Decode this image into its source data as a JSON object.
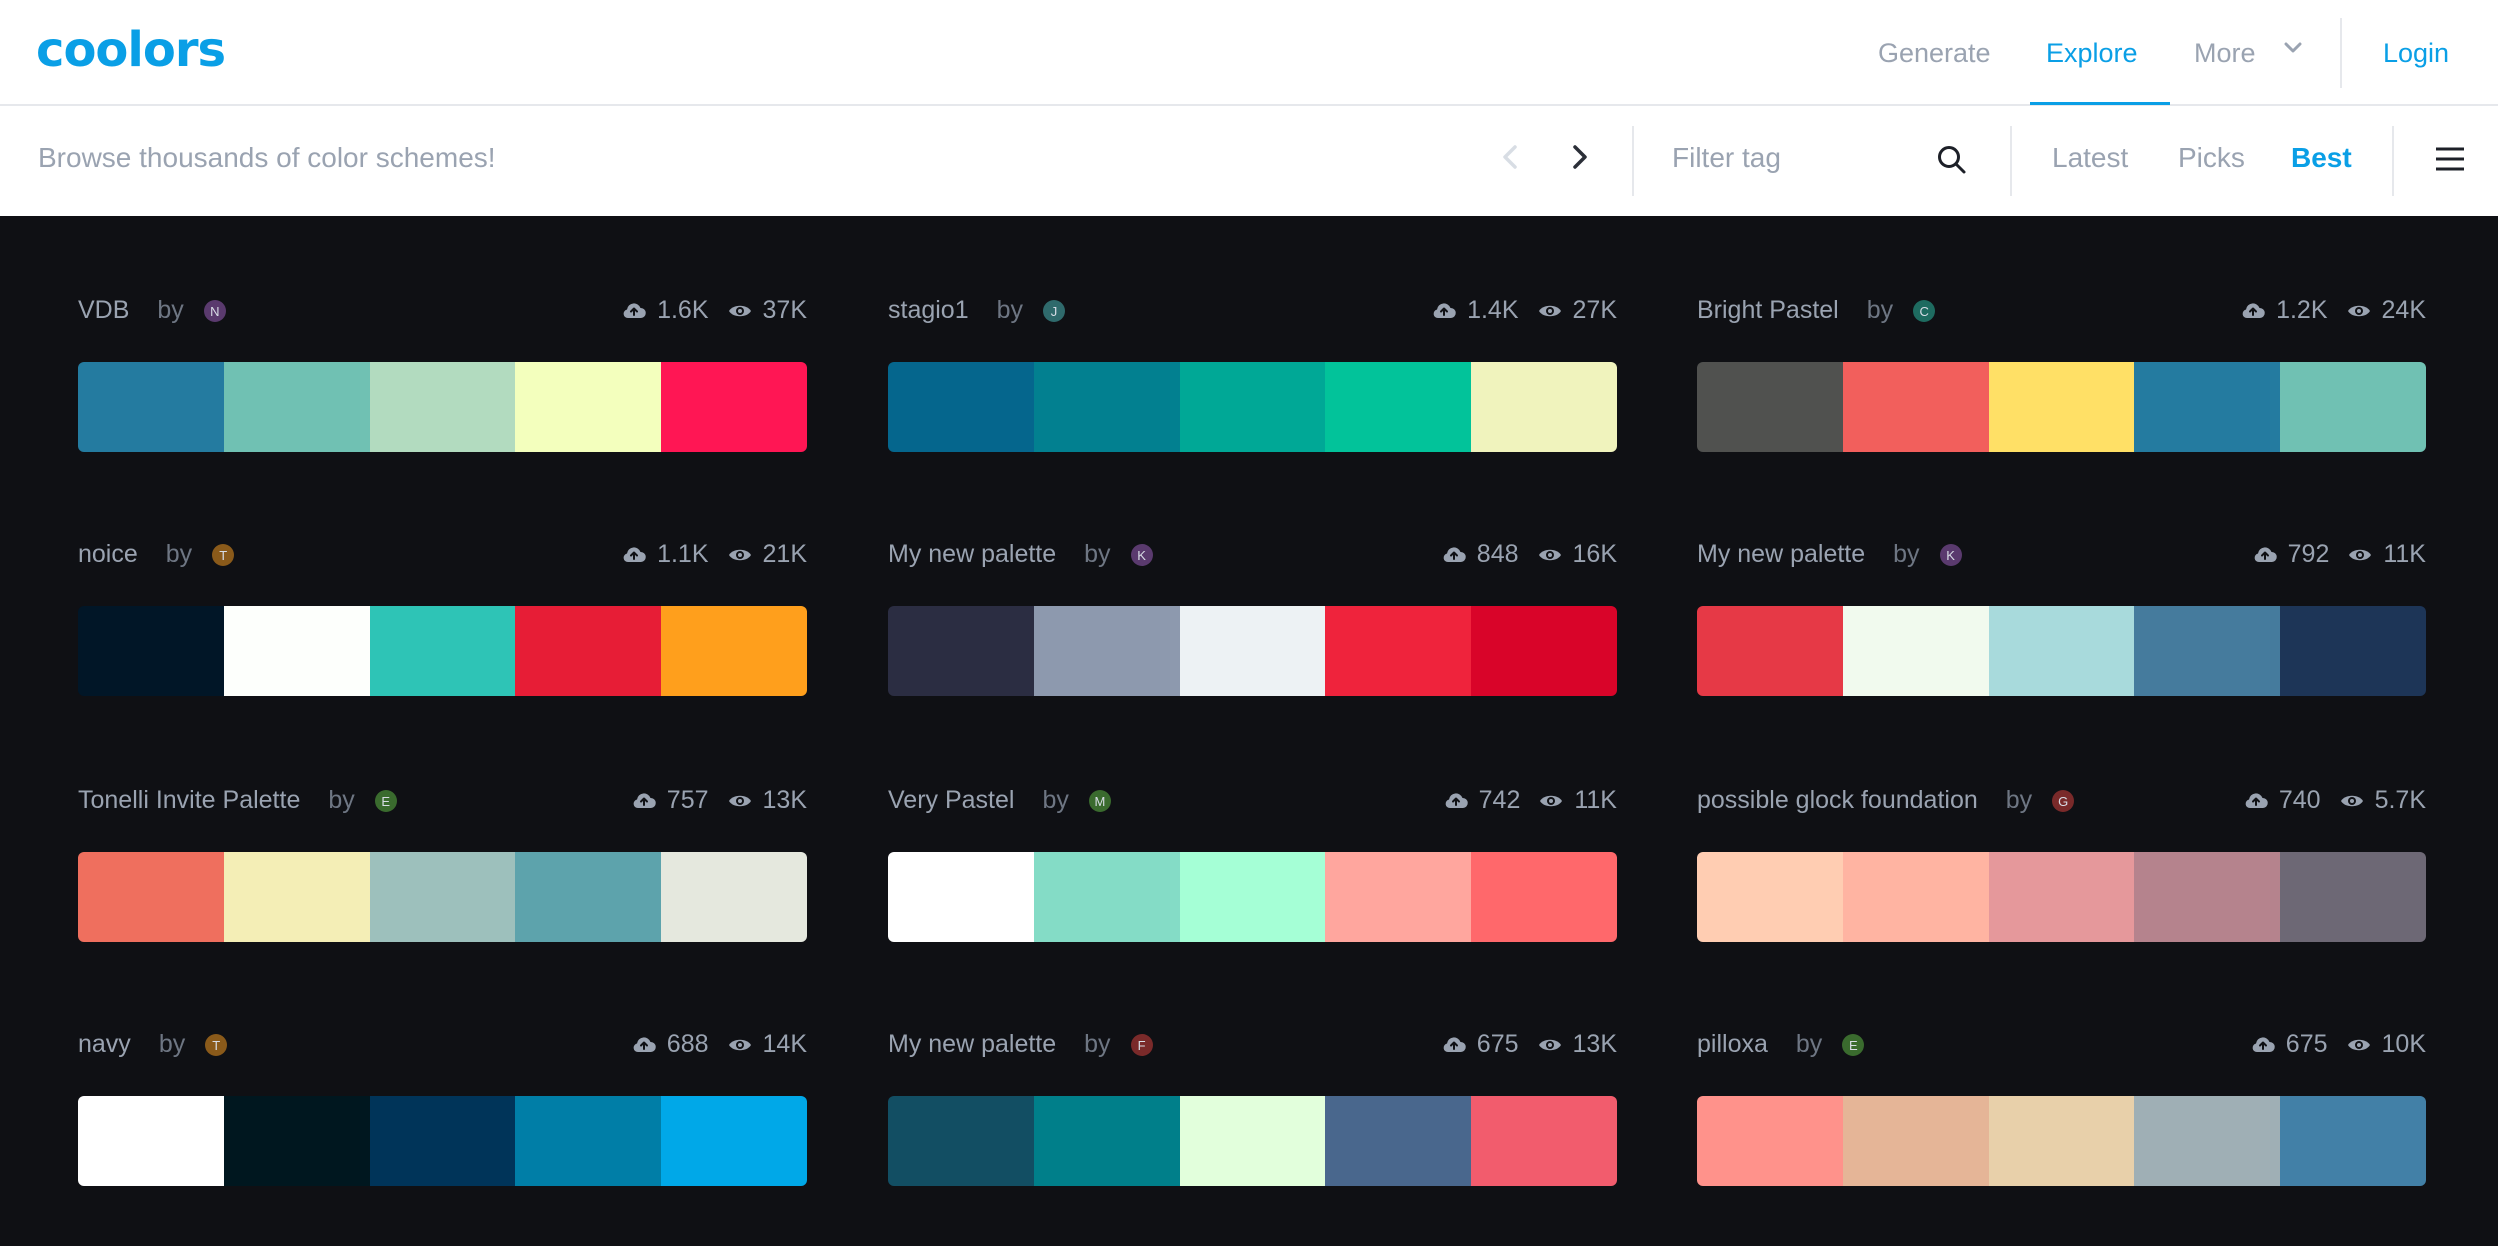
{
  "app": {
    "logo": "coolors"
  },
  "nav": {
    "generate": "Generate",
    "explore": "Explore",
    "more": "More",
    "login": "Login"
  },
  "toolbar": {
    "search_placeholder": "Browse thousands of color schemes!",
    "filter_placeholder": "Filter tag",
    "sort": {
      "latest": "Latest",
      "picks": "Picks",
      "best": "Best"
    }
  },
  "palettes": [
    {
      "name": "VDB",
      "by": "by",
      "avatar": "N",
      "avatar_color": "#5a3a6e",
      "saves": "1.6K",
      "views": "37K",
      "colors": [
        "#247BA0",
        "#70C1B3",
        "#B2DBBF",
        "#F3FFBD",
        "#FF1654"
      ]
    },
    {
      "name": "stagio1",
      "by": "by",
      "avatar": "J",
      "avatar_color": "#2f6a6c",
      "saves": "1.4K",
      "views": "27K",
      "colors": [
        "#05668D",
        "#028090",
        "#00A896",
        "#02C39A",
        "#F0F3BD"
      ]
    },
    {
      "name": "Bright Pastel",
      "by": "by",
      "avatar": "C",
      "avatar_color": "#1e6b60",
      "saves": "1.2K",
      "views": "24K",
      "colors": [
        "#50514F",
        "#F25F5C",
        "#FFE066",
        "#247BA0",
        "#70C1B3"
      ]
    },
    {
      "name": "noice",
      "by": "by",
      "avatar": "T",
      "avatar_color": "#8a5a1a",
      "saves": "1.1K",
      "views": "21K",
      "colors": [
        "#011627",
        "#FDFFFC",
        "#2EC4B6",
        "#E71D36",
        "#FF9F1C"
      ]
    },
    {
      "name": "My new palette",
      "by": "by",
      "avatar": "K",
      "avatar_color": "#5a3a6e",
      "saves": "848",
      "views": "16K",
      "colors": [
        "#2B2D42",
        "#8D99AE",
        "#EDF2F4",
        "#EF233C",
        "#D90429"
      ]
    },
    {
      "name": "My new palette",
      "by": "by",
      "avatar": "K",
      "avatar_color": "#5a3a6e",
      "saves": "792",
      "views": "11K",
      "colors": [
        "#E63946",
        "#F1FAEE",
        "#A8DADC",
        "#457B9D",
        "#1D3557"
      ]
    },
    {
      "name": "Tonelli Invite Palette",
      "by": "by",
      "avatar": "E",
      "avatar_color": "#3a6b2e",
      "saves": "757",
      "views": "13K",
      "colors": [
        "#EF6F5E",
        "#F4EEB6",
        "#9DC0BC",
        "#5DA3AC",
        "#E5E8DE"
      ]
    },
    {
      "name": "Very Pastel",
      "by": "by",
      "avatar": "M",
      "avatar_color": "#3a6b2e",
      "saves": "742",
      "views": "11K",
      "colors": [
        "#FFFFFF",
        "#84DCC6",
        "#A5FFD6",
        "#FFA69E",
        "#FF686B"
      ]
    },
    {
      "name": "possible glock foundation",
      "by": "by",
      "avatar": "G",
      "avatar_color": "#7a2a2a",
      "saves": "740",
      "views": "5.7K",
      "colors": [
        "#FFCDB2",
        "#FFB4A2",
        "#E5989B",
        "#B5838D",
        "#6D6875"
      ]
    },
    {
      "name": "navy",
      "by": "by",
      "avatar": "T",
      "avatar_color": "#8a5a1a",
      "saves": "688",
      "views": "14K",
      "colors": [
        "#FFFFFF",
        "#00171F",
        "#003459",
        "#007EA7",
        "#00A8E8"
      ]
    },
    {
      "name": "My new palette",
      "by": "by",
      "avatar": "F",
      "avatar_color": "#7a2a2a",
      "saves": "675",
      "views": "13K",
      "colors": [
        "#124E63",
        "#007F8A",
        "#E2FFDC",
        "#49678D",
        "#F25C6D"
      ]
    },
    {
      "name": "pilloxa",
      "by": "by",
      "avatar": "E",
      "avatar_color": "#3a6b2e",
      "saves": "675",
      "views": "10K",
      "colors": [
        "#FF928B",
        "#E5B597",
        "#E8D0AA",
        "#9FAFB5",
        "#4280A7"
      ]
    }
  ],
  "icons": {
    "save": "cloud-upload-icon",
    "views": "eye-icon",
    "prev": "chevron-left-icon",
    "next": "chevron-right-icon",
    "search": "search-icon",
    "menu": "hamburger-menu-icon"
  },
  "colors": {
    "accent": "#0a9fe6",
    "muted": "#9aa3b1",
    "background": "#0f1014"
  }
}
